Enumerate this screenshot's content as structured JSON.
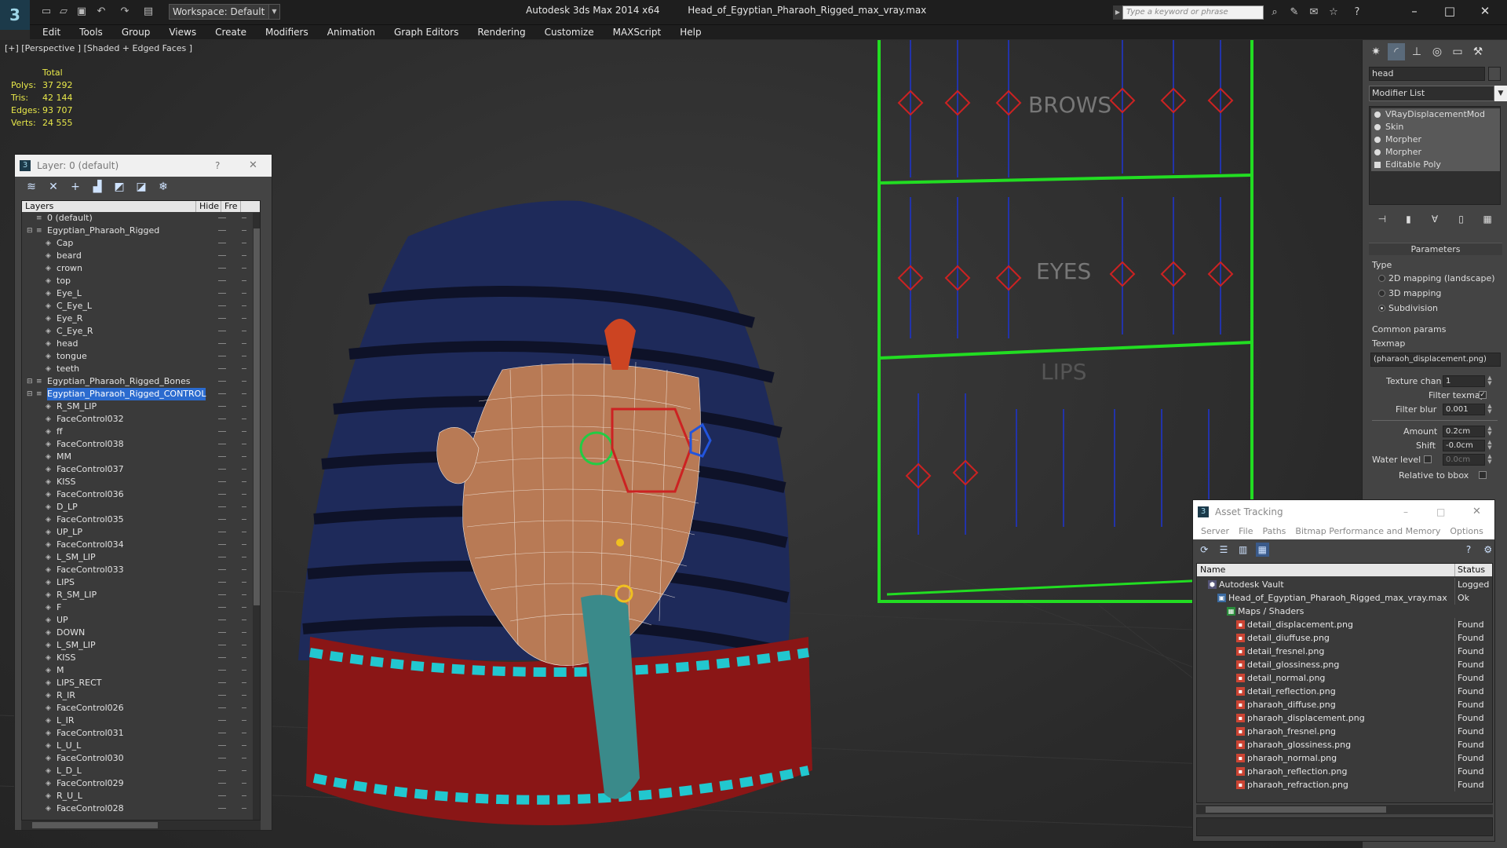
{
  "app": {
    "title": "Autodesk 3ds Max 2014 x64",
    "file": "Head_of_Egyptian_Pharaoh_Rigged_max_vray.max",
    "workspace": "Workspace: Default",
    "search_placeholder": "Type a keyword or phrase"
  },
  "menus": [
    "Edit",
    "Tools",
    "Group",
    "Views",
    "Create",
    "Modifiers",
    "Animation",
    "Graph Editors",
    "Rendering",
    "Customize",
    "MAXScript",
    "Help"
  ],
  "viewport": {
    "label": "[+] [Perspective ] [Shaded + Edged Faces ]",
    "stats": {
      "header": "Total",
      "rows": [
        {
          "k": "Polys:",
          "v": "37 292"
        },
        {
          "k": "Tris:",
          "v": "42 144"
        },
        {
          "k": "Edges:",
          "v": "93 707"
        },
        {
          "k": "Verts:",
          "v": "24 555"
        }
      ]
    },
    "rig_labels": {
      "brows": "BROWS",
      "eyes": "EYES",
      "lips": "LIPS"
    }
  },
  "layers": {
    "title": "Layer: 0 (default)",
    "help": "?",
    "close": "✕",
    "col_layers": "Layers",
    "col_hide": "Hide",
    "col_freeze": "Fre",
    "items": [
      {
        "name": "0 (default)",
        "level": 0
      },
      {
        "name": "Egyptian_Pharaoh_Rigged",
        "level": 0
      },
      {
        "name": "Cap",
        "level": 1
      },
      {
        "name": "beard",
        "level": 1
      },
      {
        "name": "crown",
        "level": 1
      },
      {
        "name": "top",
        "level": 1
      },
      {
        "name": "Eye_L",
        "level": 1
      },
      {
        "name": "C_Eye_L",
        "level": 1
      },
      {
        "name": "Eye_R",
        "level": 1
      },
      {
        "name": "C_Eye_R",
        "level": 1
      },
      {
        "name": "head",
        "level": 1
      },
      {
        "name": "tongue",
        "level": 1
      },
      {
        "name": "teeth",
        "level": 1
      },
      {
        "name": "Egyptian_Pharaoh_Rigged_Bones",
        "level": 0
      },
      {
        "name": "Egyptian_Pharaoh_Rigged_CONTROL",
        "level": 0,
        "selected": true
      },
      {
        "name": "R_SM_LIP",
        "level": 1
      },
      {
        "name": "FaceControl032",
        "level": 1
      },
      {
        "name": "ff",
        "level": 1
      },
      {
        "name": "FaceControl038",
        "level": 1
      },
      {
        "name": "MM",
        "level": 1
      },
      {
        "name": "FaceControl037",
        "level": 1
      },
      {
        "name": "KISS",
        "level": 1
      },
      {
        "name": "FaceControl036",
        "level": 1
      },
      {
        "name": "D_LP",
        "level": 1
      },
      {
        "name": "FaceControl035",
        "level": 1
      },
      {
        "name": "UP_LP",
        "level": 1
      },
      {
        "name": "FaceControl034",
        "level": 1
      },
      {
        "name": "L_SM_LIP",
        "level": 1
      },
      {
        "name": "FaceControl033",
        "level": 1
      },
      {
        "name": "LIPS",
        "level": 1
      },
      {
        "name": "R_SM_LIP",
        "level": 1
      },
      {
        "name": "F",
        "level": 1
      },
      {
        "name": "UP",
        "level": 1
      },
      {
        "name": "DOWN",
        "level": 1
      },
      {
        "name": "L_SM_LIP",
        "level": 1
      },
      {
        "name": "KISS",
        "level": 1
      },
      {
        "name": "M",
        "level": 1
      },
      {
        "name": "LIPS_RECT",
        "level": 1
      },
      {
        "name": "R_IR",
        "level": 1
      },
      {
        "name": "FaceControl026",
        "level": 1
      },
      {
        "name": "L_IR",
        "level": 1
      },
      {
        "name": "FaceControl031",
        "level": 1
      },
      {
        "name": "L_U_L",
        "level": 1
      },
      {
        "name": "FaceControl030",
        "level": 1
      },
      {
        "name": "L_D_L",
        "level": 1
      },
      {
        "name": "FaceControl029",
        "level": 1
      },
      {
        "name": "R_U_L",
        "level": 1
      },
      {
        "name": "FaceControl028",
        "level": 1
      }
    ]
  },
  "command_panel": {
    "object_name": "head",
    "modifier_list": "Modifier List",
    "stack": [
      "VRayDisplacementMod",
      "Skin",
      "Morpher",
      "Morpher",
      "Editable Poly"
    ],
    "parameters": {
      "rollout": "Parameters",
      "type_label": "Type",
      "types": [
        "2D mapping (landscape)",
        "3D mapping",
        "Subdivision"
      ],
      "selected_type": 2,
      "common": "Common params",
      "texmap_label": "Texmap",
      "texmap": "(pharaoh_displacement.png)",
      "texture_chan_label": "Texture chan",
      "texture_chan": "1",
      "filter_texmap_label": "Filter texmap",
      "filter_blur_label": "Filter blur",
      "filter_blur": "0.001",
      "amount_label": "Amount",
      "amount": "0.2cm",
      "shift_label": "Shift",
      "shift": "-0.0cm",
      "water_label": "Water level",
      "water": "0.0cm",
      "relative_label": "Relative to bbox"
    }
  },
  "asset_tracking": {
    "title": "Asset Tracking",
    "menu": [
      "Server",
      "File",
      "Paths",
      "Bitmap Performance and Memory",
      "Options"
    ],
    "col_name": "Name",
    "col_status": "Status",
    "rows": [
      {
        "name": "Autodesk Vault",
        "status": "Logged O",
        "level": 0,
        "icon": "vault"
      },
      {
        "name": "Head_of_Egyptian_Pharaoh_Rigged_max_vray.max",
        "status": "Ok",
        "level": 1,
        "icon": "max"
      },
      {
        "name": "Maps / Shaders",
        "status": "",
        "level": 2,
        "icon": "maps"
      },
      {
        "name": "detail_displacement.png",
        "status": "Found",
        "level": 3,
        "icon": "png"
      },
      {
        "name": "detail_diuffuse.png",
        "status": "Found",
        "level": 3,
        "icon": "png"
      },
      {
        "name": "detail_fresnel.png",
        "status": "Found",
        "level": 3,
        "icon": "png"
      },
      {
        "name": "detail_glossiness.png",
        "status": "Found",
        "level": 3,
        "icon": "png"
      },
      {
        "name": "detail_normal.png",
        "status": "Found",
        "level": 3,
        "icon": "png"
      },
      {
        "name": "detail_reflection.png",
        "status": "Found",
        "level": 3,
        "icon": "png"
      },
      {
        "name": "pharaoh_diffuse.png",
        "status": "Found",
        "level": 3,
        "icon": "png"
      },
      {
        "name": "pharaoh_displacement.png",
        "status": "Found",
        "level": 3,
        "icon": "png"
      },
      {
        "name": "pharaoh_fresnel.png",
        "status": "Found",
        "level": 3,
        "icon": "png"
      },
      {
        "name": "pharaoh_glossiness.png",
        "status": "Found",
        "level": 3,
        "icon": "png"
      },
      {
        "name": "pharaoh_normal.png",
        "status": "Found",
        "level": 3,
        "icon": "png"
      },
      {
        "name": "pharaoh_reflection.png",
        "status": "Found",
        "level": 3,
        "icon": "png"
      },
      {
        "name": "pharaoh_refraction.png",
        "status": "Found",
        "level": 3,
        "icon": "png"
      }
    ]
  },
  "colors": {
    "accent": "#2b6bcf",
    "rig_green": "#22dd22",
    "stats_yellow": "#e8e84a"
  }
}
